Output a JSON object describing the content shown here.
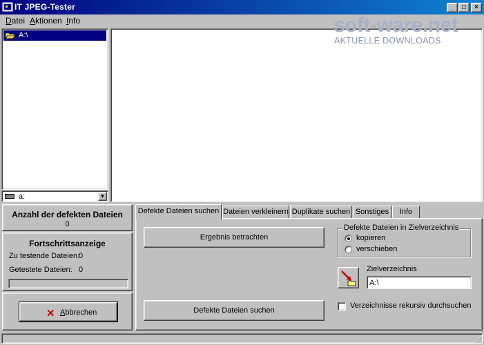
{
  "window": {
    "title": "IT JPEG-Tester"
  },
  "title_buttons": {
    "minimize": "_",
    "maximize": "□",
    "close": "×"
  },
  "menu": [
    {
      "label": "Datei",
      "accel": "D",
      "rest": "atei"
    },
    {
      "label": "Aktionen",
      "accel": "A",
      "rest": "ktionen"
    },
    {
      "label": "Info",
      "accel": "I",
      "rest": "nfo"
    }
  ],
  "watermark": {
    "brand": "soft-ware.net",
    "subtitle": "AKTUELLE DOWNLOADS"
  },
  "tree": {
    "selected_item": "A:\\"
  },
  "drive_combo": {
    "value": "a:",
    "icon": "floppy-drive-icon"
  },
  "defect_panel": {
    "title": "Anzahl der defekten Dateien",
    "count": "0"
  },
  "progress_panel": {
    "title": "Fortschrittsanzeige",
    "to_test_label": "Zu testende Dateien:",
    "to_test_value": "0",
    "tested_label": "Getestete Dateien:",
    "tested_value": "0",
    "progress": 0
  },
  "cancel_button": {
    "label": "Abbrechen",
    "icon": "red-x-icon"
  },
  "tabs": [
    {
      "label": "Defekte Dateien suchen",
      "active": true
    },
    {
      "label": "Dateien verkleinern",
      "active": false
    },
    {
      "label": "Duplikate suchen",
      "active": false
    },
    {
      "label": "Sonstiges",
      "active": false
    },
    {
      "label": "Info",
      "active": false
    }
  ],
  "search_tab": {
    "result_button": "Ergebnis betrachten",
    "search_button": "Defekte Dateien suchen",
    "group_title": "Defekte Dateien in Zielverzeichnis",
    "radio_copy": "kopieren",
    "radio_move": "verschieben",
    "selected_radio": "kopieren",
    "target_dir_label": "Zielverzeichnis",
    "target_dir_value": "A:\\",
    "recursive_label": "Verzeichnisse rekursiv durchsuchen",
    "recursive_checked": false
  },
  "colors": {
    "titlebar_start": "#000080",
    "titlebar_end": "#1084d0",
    "selection": "#000080",
    "face": "#c0c0c0"
  }
}
